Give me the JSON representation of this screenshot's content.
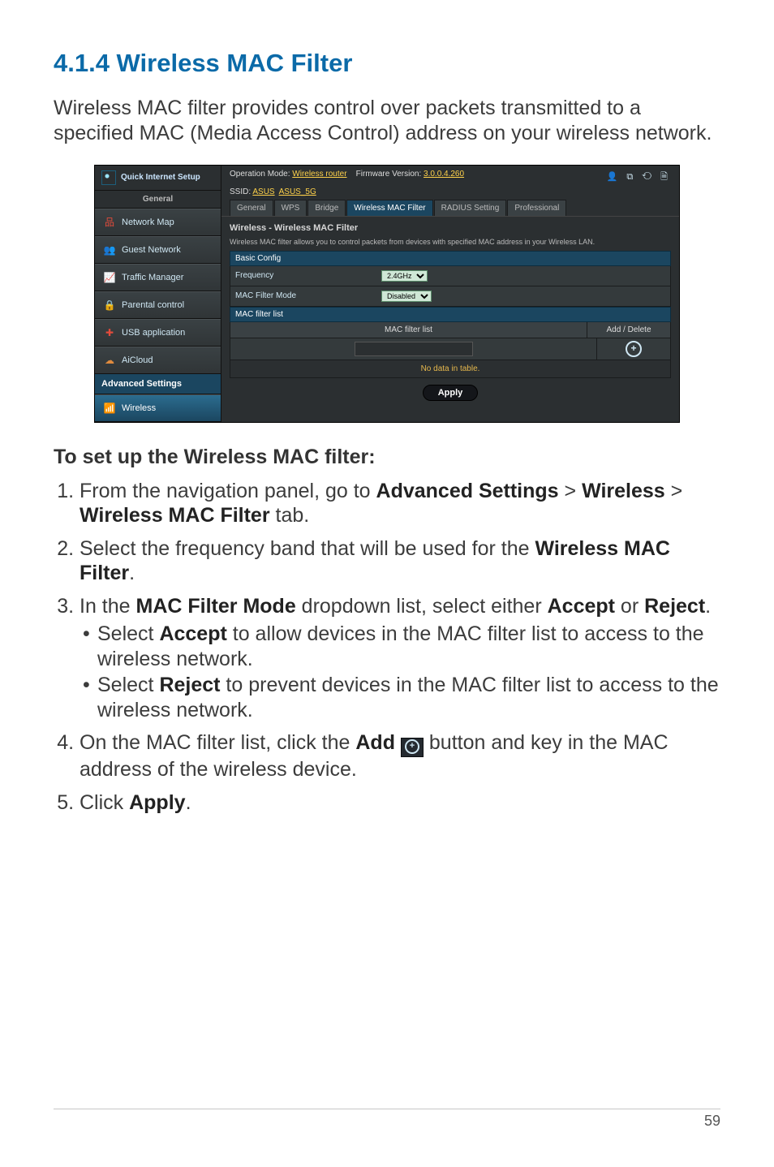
{
  "section": {
    "number": "4.1.4",
    "title": "Wireless MAC Filter",
    "full_heading": "4.1.4 Wireless MAC Filter",
    "intro": "Wireless MAC filter provides control over packets transmitted to a specified MAC (Media Access Control) address on your wireless network."
  },
  "router_ui": {
    "quick_setup": "Quick Internet Setup",
    "general_label": "General",
    "nav_general": [
      {
        "label": "Network Map",
        "icon_name": "network-map-icon",
        "icon_glyph": "品",
        "color": "ni-red"
      },
      {
        "label": "Guest Network",
        "icon_name": "guest-network-icon",
        "icon_glyph": "👥",
        "color": "ni-yellow"
      },
      {
        "label": "Traffic Manager",
        "icon_name": "traffic-manager-icon",
        "icon_glyph": "📈",
        "color": "ni-blue"
      },
      {
        "label": "Parental control",
        "icon_name": "parental-control-icon",
        "icon_glyph": "🔒",
        "color": "ni-green"
      },
      {
        "label": "USB application",
        "icon_name": "usb-application-icon",
        "icon_glyph": "✚",
        "color": "ni-red"
      },
      {
        "label": "AiCloud",
        "icon_name": "aicloud-icon",
        "icon_glyph": "☁",
        "color": "ni-orange"
      }
    ],
    "adv_label": "Advanced Settings",
    "nav_adv_active": "Wireless",
    "top": {
      "op_mode_label": "Operation Mode:",
      "op_mode_value": "Wireless router",
      "fw_label": "Firmware Version:",
      "fw_value": "3.0.0.4.260",
      "icons": "👤 ⧉ ⟲ 🗎",
      "ssid_label": "SSID:",
      "ssid1": "ASUS",
      "ssid2": "ASUS_5G"
    },
    "tabs": [
      "General",
      "WPS",
      "Bridge",
      "Wireless MAC Filter",
      "RADIUS Setting",
      "Professional"
    ],
    "active_tab": "Wireless MAC Filter",
    "panel": {
      "title": "Wireless - Wireless MAC Filter",
      "desc": "Wireless MAC filter allows you to control packets from devices with specified MAC address in your Wireless LAN.",
      "basic_config_hdr": "Basic Config",
      "freq_label": "Frequency",
      "freq_value": "2.4GHz",
      "mode_label": "MAC Filter Mode",
      "mode_value": "Disabled",
      "list_hdr": "MAC filter list",
      "col_mac": "MAC filter list",
      "col_action": "Add / Delete",
      "no_data": "No data in table.",
      "apply": "Apply"
    }
  },
  "instructions": {
    "subhead": "To set up the Wireless MAC filter:",
    "steps": {
      "s1_a": "From the navigation panel, go to ",
      "s1_b": "Advanced Settings",
      "s1_c": " > ",
      "s1_d": "Wireless",
      "s1_e": " > ",
      "s1_f": "Wireless MAC Filter",
      "s1_g": " tab.",
      "s2_a": "Select the frequency band that will be used for the ",
      "s2_b": "Wireless MAC Filter",
      "s2_c": ".",
      "s3_a": "In the ",
      "s3_b": "MAC Filter Mode",
      "s3_c": " dropdown list, select either ",
      "s3_d": "Accept",
      "s3_e": " or ",
      "s3_f": "Reject",
      "s3_g": ".",
      "s3_sub1_a": "Select ",
      "s3_sub1_b": "Accept",
      "s3_sub1_c": " to allow devices in the MAC filter list to access to the wireless network.",
      "s3_sub2_a": "Select ",
      "s3_sub2_b": "Reject",
      "s3_sub2_c": " to prevent devices in the MAC filter list to access to the wireless network.",
      "s4_a": "On the MAC filter list, click the ",
      "s4_b": "Add",
      "s4_c": "  button and key in the MAC address of the wireless device.",
      "s5_a": "Click ",
      "s5_b": "Apply",
      "s5_c": "."
    }
  },
  "page_number": "59"
}
